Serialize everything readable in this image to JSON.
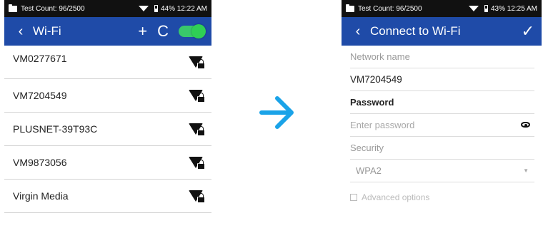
{
  "left": {
    "status": {
      "count": "Test Count: 96/2500",
      "battery_time": "44% 12:22 AM"
    },
    "appbar": {
      "back": "‹",
      "title": "Wi-Fi",
      "add": "+",
      "refresh": "C"
    },
    "networks": [
      {
        "name": "VM0277671",
        "signal_icon": "wifi-locked-icon"
      },
      {
        "name": "VM7204549",
        "signal_icon": "wifi-locked-icon"
      },
      {
        "name": "PLUSNET-39T93C",
        "signal_icon": "wifi-locked-icon"
      },
      {
        "name": "VM9873056",
        "signal_icon": "wifi-locked-icon"
      },
      {
        "name": "Virgin Media",
        "signal_icon": "wifi-locked-icon"
      }
    ]
  },
  "right": {
    "status": {
      "count": "Test Count: 96/2500",
      "battery_time": "43% 12:25 AM"
    },
    "appbar": {
      "back": "‹",
      "title": "Connect to Wi-Fi",
      "confirm": "✓"
    },
    "form": {
      "network_name_label": "Network name",
      "network_name_value": "VM7204549",
      "password_label": "Password",
      "password_placeholder": "Enter password",
      "security_label": "Security",
      "security_value": "WPA2",
      "advanced_label": "Advanced options"
    }
  },
  "colors": {
    "appbar": "#1f4ba8",
    "arrow": "#1aa3e8",
    "toggle_on": "#39c86b",
    "statusbar": "#111111"
  }
}
